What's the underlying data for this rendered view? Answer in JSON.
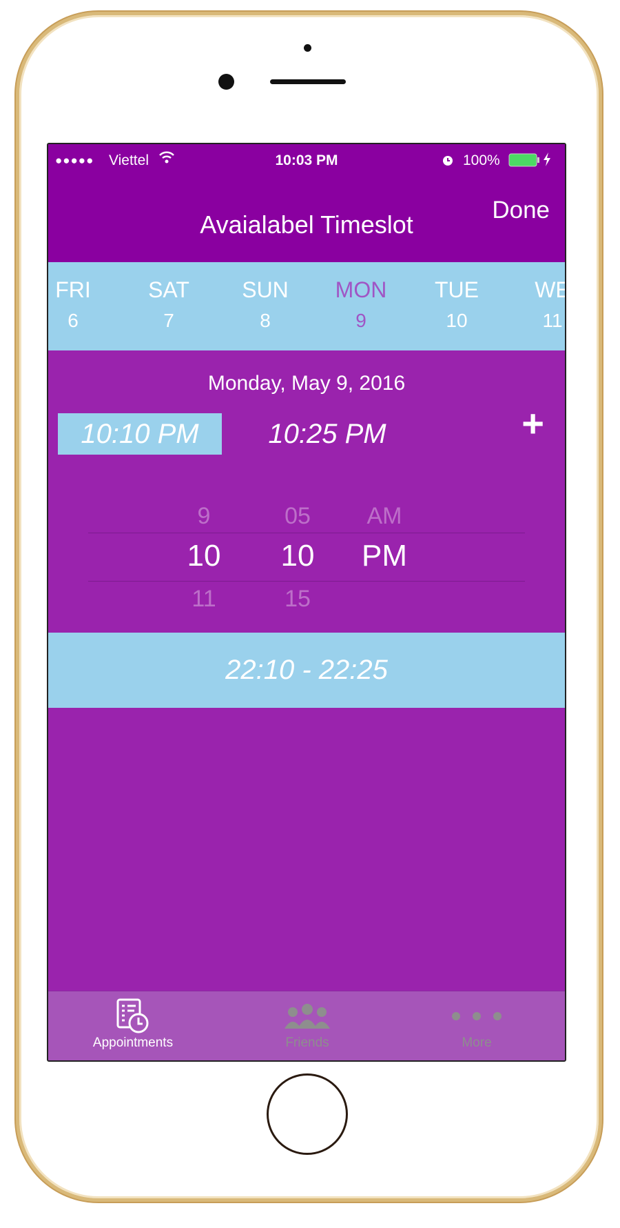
{
  "status_bar": {
    "signal": "●●●●●",
    "carrier": "Viettel",
    "time": "10:03 PM",
    "battery": "100%",
    "icons": [
      "wifi-icon",
      "alarm-icon",
      "battery-icon",
      "charging-icon"
    ]
  },
  "nav": {
    "title": "Avaialabel Timeslot",
    "done_label": "Done"
  },
  "days": [
    {
      "name": "FRI",
      "date": "6"
    },
    {
      "name": "SAT",
      "date": "7"
    },
    {
      "name": "SUN",
      "date": "8"
    },
    {
      "name": "MON",
      "date": "9",
      "selected": true
    },
    {
      "name": "TUE",
      "date": "10"
    },
    {
      "name": "WE",
      "date": "11"
    }
  ],
  "selected_date": "Monday, May 9, 2016",
  "start_time": "10:10 PM",
  "end_time": "10:25 PM",
  "add_label": "+",
  "picker": {
    "hours": [
      "9",
      "10",
      "11"
    ],
    "minutes": [
      "05",
      "10",
      "15"
    ],
    "period": [
      "AM",
      "PM"
    ]
  },
  "timeslot_range": "22:10 - 22:25",
  "tabbar": [
    {
      "label": "Appointments",
      "icon": "appointments-icon",
      "active": true
    },
    {
      "label": "Friends",
      "icon": "friends-icon"
    },
    {
      "label": "More",
      "icon": "more-icon"
    }
  ],
  "colors": {
    "header": "#8a00a0",
    "content": "#9a23ad",
    "accent_blue": "#9ad1ec",
    "tabbar": "#a655b9",
    "selected_day": "#a055c5",
    "inactive_tab": "#8e8e8e"
  }
}
